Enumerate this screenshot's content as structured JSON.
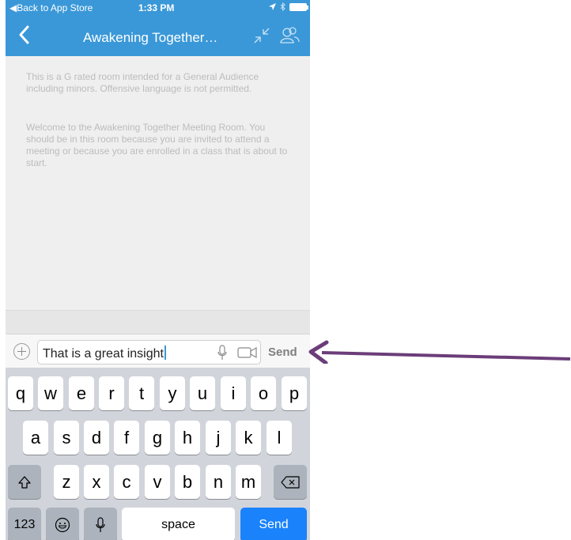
{
  "status_bar": {
    "back_label": "◀Back to App Store",
    "time": "1:33 PM"
  },
  "nav": {
    "title": "Awakening Together…",
    "icons": [
      "chevron-left-icon",
      "collapse-arrows-icon",
      "people-icon"
    ]
  },
  "chat": {
    "messages": [
      "This is a G rated room intended for a General Audience including minors.  Offensive language is not permitted.",
      "Welcome to the Awakening Together Meeting Room.  You should be in this room because you are invited to attend a meeting or because you are enrolled in a class that is about to start."
    ]
  },
  "input_bar": {
    "value": "That is a great insight",
    "send_label": "Send"
  },
  "keyboard": {
    "row1": [
      "q",
      "w",
      "e",
      "r",
      "t",
      "y",
      "u",
      "i",
      "o",
      "p"
    ],
    "row2": [
      "a",
      "s",
      "d",
      "f",
      "g",
      "h",
      "j",
      "k",
      "l"
    ],
    "row3": [
      "z",
      "x",
      "c",
      "v",
      "b",
      "n",
      "m"
    ],
    "numbers_label": "123",
    "space_label": "space",
    "send_label": "Send"
  },
  "colors": {
    "header": "#3a98d8",
    "keyboard_bg": "#d1d5db",
    "send_key": "#1a82fb",
    "annotation_arrow": "#6b3d79"
  }
}
